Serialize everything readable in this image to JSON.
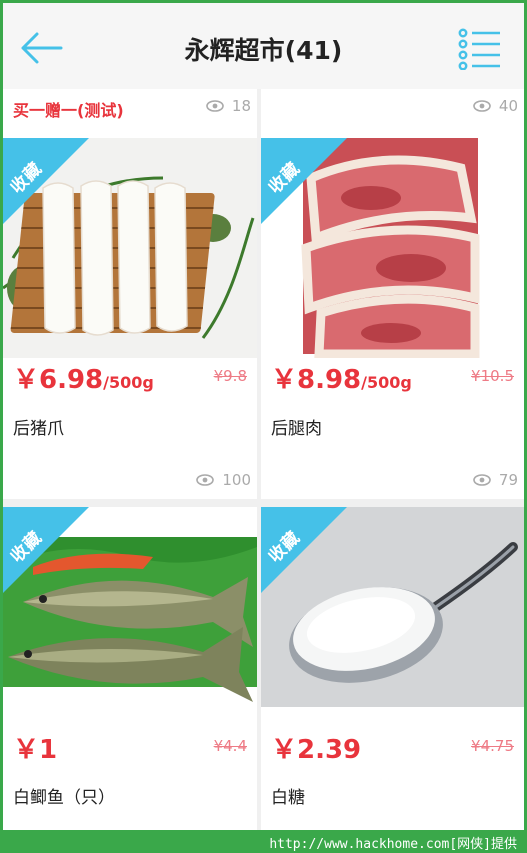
{
  "header": {
    "title": "永辉超市(41)"
  },
  "products": [
    {
      "promo": "买一赠一(测试)",
      "top_views": "18",
      "favorite": "收藏",
      "price": "￥6.98",
      "unit": "/500g",
      "old_price": "¥9.8",
      "name": "后猪爪",
      "bottom_views": "100"
    },
    {
      "top_views": "40",
      "favorite": "收藏",
      "price": "￥8.98",
      "unit": "/500g",
      "old_price": "¥10.5",
      "name": "后腿肉",
      "bottom_views": "79"
    },
    {
      "favorite": "收藏",
      "price": "￥1",
      "old_price": "¥4.4",
      "name": "白鲫鱼（只）"
    },
    {
      "favorite": "收藏",
      "price": "￥2.39",
      "old_price": "¥4.75",
      "name": "白糖"
    }
  ],
  "footer": {
    "text": "http://www.hackhome.com[网侠]提供"
  },
  "colors": {
    "accent": "#45c1e8",
    "price": "#e8343c",
    "watermark_bar": "#3aa84a"
  },
  "icons": [
    "back-arrow-icon",
    "list-menu-icon",
    "eye-icon"
  ]
}
